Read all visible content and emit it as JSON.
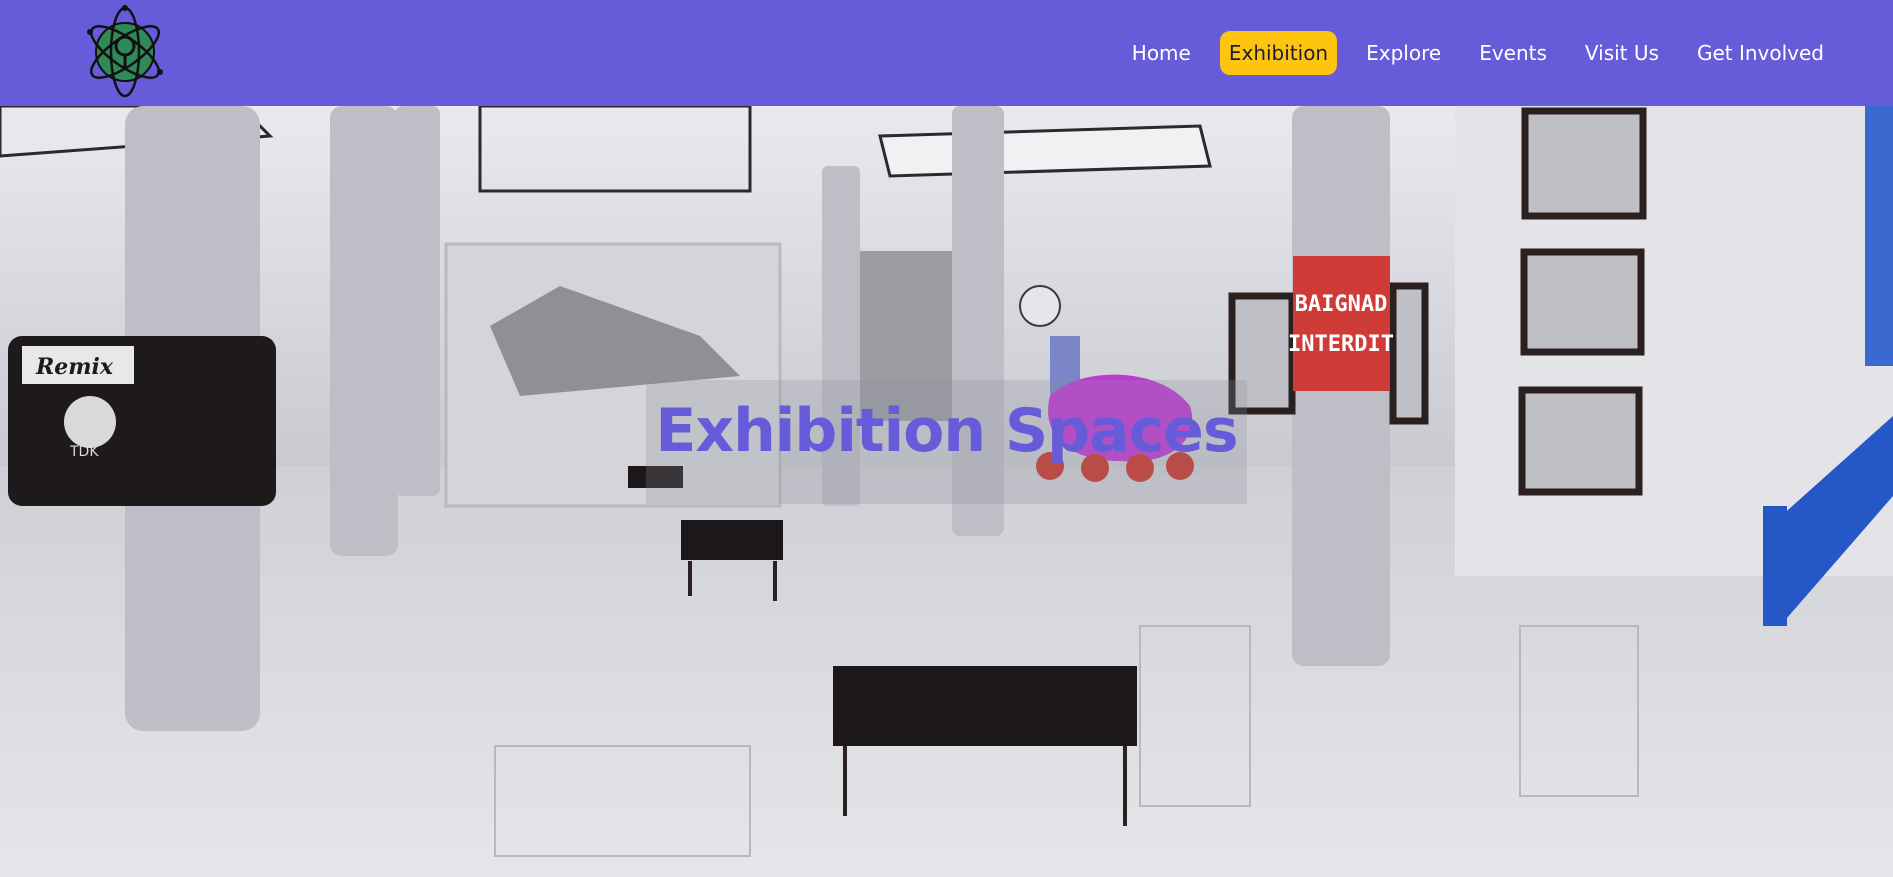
{
  "header": {
    "logo_icon": "atom-logo-icon",
    "nav": [
      {
        "label": "Home",
        "active": false
      },
      {
        "label": "Exhibition",
        "active": true
      },
      {
        "label": "Explore",
        "active": false
      },
      {
        "label": "Events",
        "active": false
      },
      {
        "label": "Visit Us",
        "active": false
      },
      {
        "label": "Get Involved",
        "active": false
      }
    ]
  },
  "hero": {
    "title": "Exhibition Spaces",
    "image_subject": "museum-gallery-hall",
    "sign_text": [
      "BAIGNAD",
      "INTERDIT"
    ],
    "poster_text": "Remix",
    "poster_brand": "TDK"
  },
  "colors": {
    "nav_bg": "#665bd9",
    "nav_active_bg": "#fdc50d",
    "title": "#665bd9"
  }
}
